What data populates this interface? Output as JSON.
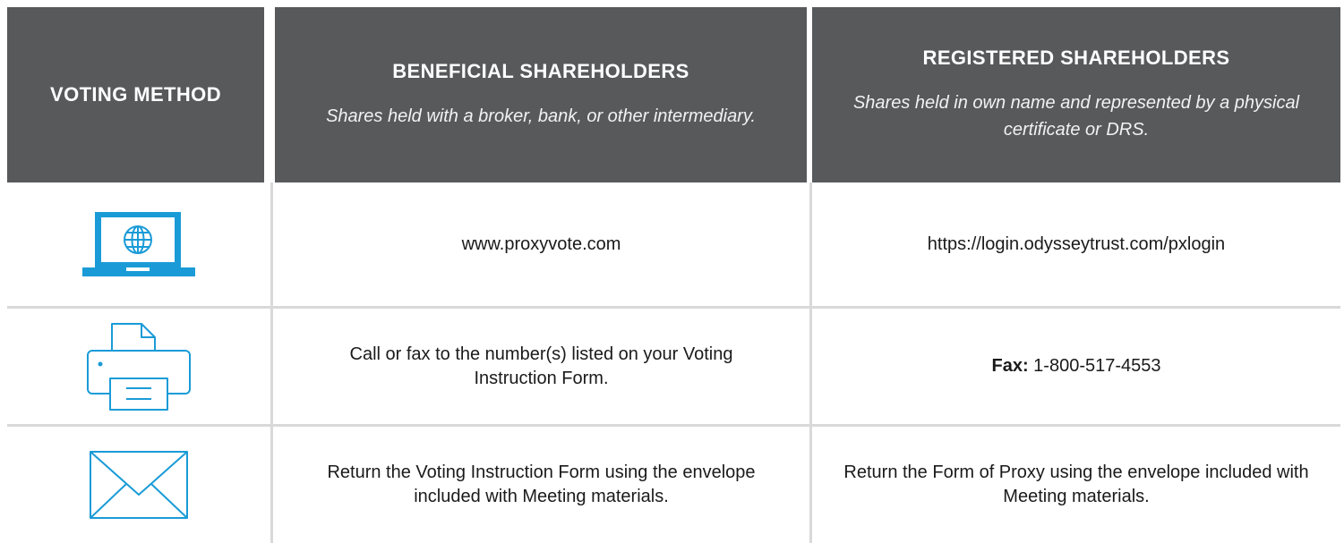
{
  "header": {
    "voting_method": "VOTING METHOD",
    "beneficial": {
      "title": "BENEFICIAL SHAREHOLDERS",
      "subtitle": "Shares held with a broker, bank, or other intermediary."
    },
    "registered": {
      "title": "REGISTERED SHAREHOLDERS",
      "subtitle": "Shares held in own name and represented by a physical certificate or DRS."
    }
  },
  "rows": [
    {
      "icon": "laptop-globe-icon",
      "beneficial": "www.proxyvote.com",
      "registered": "https://login.odysseytrust.com/pxlogin"
    },
    {
      "icon": "fax-printer-icon",
      "beneficial": "Call or fax to the number(s) listed on your Voting Instruction Form.",
      "registered_label": "Fax:",
      "registered_value": " 1-800-517-4553"
    },
    {
      "icon": "mail-envelope-icon",
      "beneficial": "Return the Voting Instruction Form  using the envelope included with Meeting materials.",
      "registered": "Return the Form of Proxy using the envelope included with Meeting materials."
    }
  ],
  "colors": {
    "header_bg": "#58595b",
    "icon_accent": "#1a9bd7",
    "grid_line": "#d9d9d9"
  }
}
